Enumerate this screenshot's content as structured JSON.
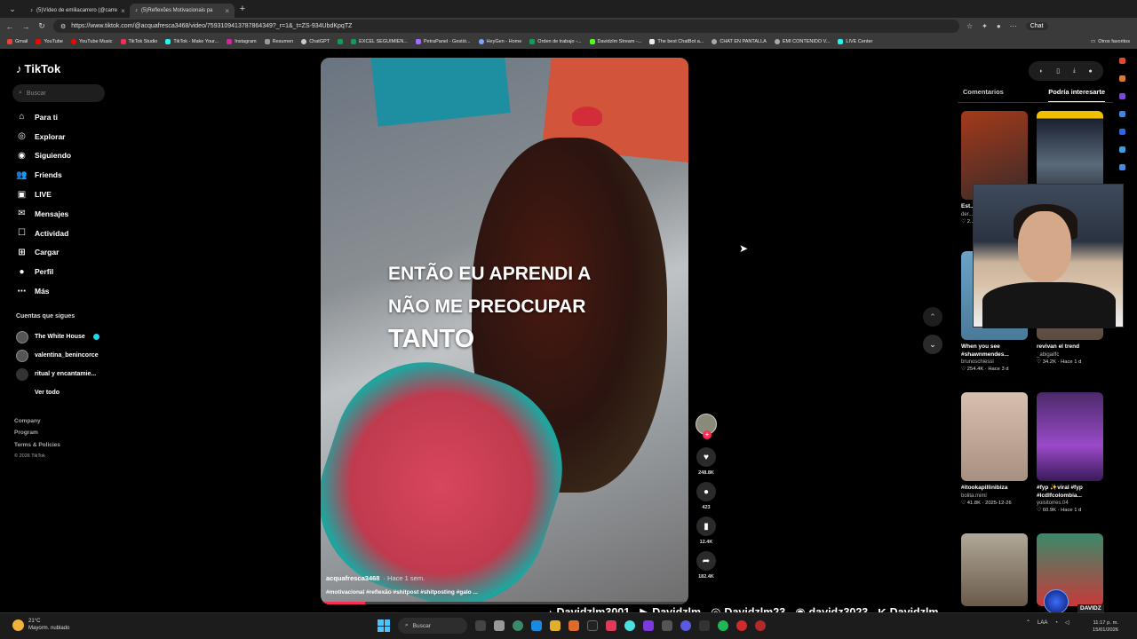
{
  "browser": {
    "tabs": [
      {
        "title": "(5)Vídeo de emiliacarrero (@carre",
        "active": false
      },
      {
        "title": "(5)Reflexões Motivacionais pa",
        "active": true
      }
    ],
    "url": "https://www.tiktok.com/@acquafresca3468/video/7593109413787864349?_r=1&_t=ZS-934UbdKpqTZ",
    "chat_label": "Chat",
    "bookmarks": [
      "Gmail",
      "YouTube",
      "YouTube Music",
      "TikTok Studio",
      "TikTok - Make Your...",
      "Instagram",
      "Resumen",
      "ChatGPT",
      "",
      "EXCEL SEGUIMIEN...",
      "PetraPanel - Gestió...",
      "HeyGen - Home",
      "Orden de trabajo -...",
      "Davidzlm Stream -...",
      "The best ChatBot a...",
      "CHAT EN PANTALLA",
      "EMI CONTENIDO V...",
      "LIVE Center"
    ],
    "bookmarks_other": "Otros favoritos"
  },
  "sidebar": {
    "logo": "TikTok",
    "search_placeholder": "Buscar",
    "nav": [
      {
        "label": "Para ti",
        "icon": "home-icon"
      },
      {
        "label": "Explorar",
        "icon": "compass-icon"
      },
      {
        "label": "Siguiendo",
        "icon": "following-icon"
      },
      {
        "label": "Friends",
        "icon": "friends-icon"
      },
      {
        "label": "LIVE",
        "icon": "live-icon"
      },
      {
        "label": "Mensajes",
        "icon": "messages-icon"
      },
      {
        "label": "Actividad",
        "icon": "activity-icon"
      },
      {
        "label": "Cargar",
        "icon": "upload-icon"
      },
      {
        "label": "Perfil",
        "icon": "profile-icon"
      },
      {
        "label": "Más",
        "icon": "more-icon"
      }
    ],
    "following_title": "Cuentas que sigues",
    "following": [
      "The White House",
      "valentina_benincorce",
      "ritual y encantamie...",
      "Ver todo"
    ],
    "footer": [
      "Company",
      "Program",
      "Terms & Policies",
      "© 2026 TikTok"
    ]
  },
  "video": {
    "caption_lines": [
      "ENTÃO EU APRENDI A",
      "NÃO ME PREOCUPAR",
      "TANTO"
    ],
    "author": "acquafresca3468",
    "posted": "· Hace 1 sem.",
    "tags": "#motivacional #reflexão #shitpost #shitposting #galo ...",
    "progress": 0.12,
    "likes": "248.8K",
    "comments": "423",
    "saves": "12.4K",
    "shares": "182.4K"
  },
  "right_panel": {
    "tabs": [
      "Comentarios",
      "Podría interesarte"
    ],
    "cards": [
      {
        "title": "Est... que...",
        "user": "der...",
        "stats": "♡ 2...",
        "color": "#5b2a20"
      },
      {
        "title": "",
        "user": "",
        "stats": "",
        "color": "#2c3440"
      },
      {
        "title": "When you see #shawnmendes...",
        "user": "brunoschiessl",
        "stats": "♡ 254.4K · Hace 3 d",
        "color": "#5a8fb0"
      },
      {
        "title": "revivan el trend",
        "user": "_abigailfc",
        "stats": "♡ 34.2K · Hace 1 d",
        "color": "#6a5a50"
      },
      {
        "title": "#itookapillinibiza",
        "user": "bolita.mimi",
        "stats": "♡ 41.8K · 2025-12-26",
        "color": "#b49a8c"
      },
      {
        "title": "#fyp ✨viral #fyp #lcdlfcolombia...",
        "user": "yoisitorres.04",
        "stats": "♡ 60.9K · Hace 1 d",
        "color": "#6a3a8a"
      },
      {
        "title": "",
        "user": "",
        "stats": "",
        "color": "#8a7a6a"
      },
      {
        "title": "",
        "user": "",
        "stats": "",
        "color": "#3a6a5a"
      }
    ]
  },
  "stream_overlay": {
    "tiktok": "Davidzlm3001",
    "youtube": "Davidzlm",
    "instagram": "Davidzlm23",
    "discord": "davidz3023",
    "kick": "Davidzlm",
    "badge": "DAVIDZ"
  },
  "taskbar": {
    "temp": "21°C",
    "weather": "Mayorm. nublado",
    "search": "Buscar",
    "lang": "LAA",
    "time": "11:17 p. m.",
    "date": "15/01/2026"
  }
}
